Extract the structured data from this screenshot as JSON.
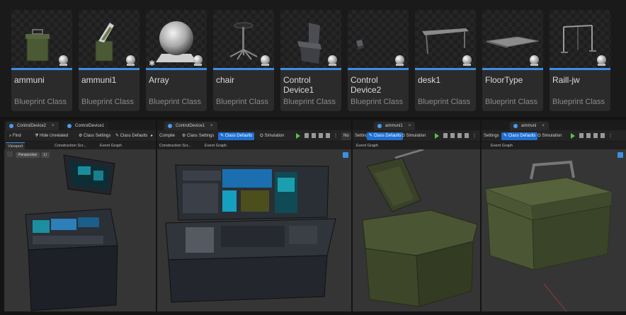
{
  "assets": [
    {
      "name": "ammuni",
      "type": "Blueprint Class",
      "icon": "ammo-box-icon"
    },
    {
      "name": "ammuni1",
      "type": "Blueprint Class",
      "icon": "ammo-box-open-icon"
    },
    {
      "name": "Array",
      "type": "Blueprint Class",
      "icon": "sphere-icon"
    },
    {
      "name": "chair",
      "type": "Blueprint Class",
      "icon": "office-chair-icon"
    },
    {
      "name": "Control Device1",
      "type": "Blueprint Class",
      "icon": "control-device-icon"
    },
    {
      "name": "Control Device2",
      "type": "Blueprint Class",
      "icon": "small-device-icon"
    },
    {
      "name": "desk1",
      "type": "Blueprint Class",
      "icon": "desk-icon"
    },
    {
      "name": "FloorType",
      "type": "Blueprint Class",
      "icon": "floor-tile-icon"
    },
    {
      "name": "Raill-jw",
      "type": "Blueprint Class",
      "icon": "rail-icon"
    }
  ],
  "editors": [
    {
      "tabs": [
        "ControlDevice2",
        "ControlDevice1"
      ],
      "toolbar": {
        "first": "Find",
        "second": "Hide Unrelated",
        "third": "Class Settings",
        "fourth": "Class Defaults"
      },
      "subtabs": [
        "Viewport",
        "Construction Scr...",
        "Event Graph"
      ],
      "viewport": {
        "mode": "Perspective",
        "lit": "Li"
      }
    },
    {
      "tabs": [
        "ControlDevice1"
      ],
      "toolbar": {
        "first": "Compile",
        "second": "Class Settings",
        "third": "Class Defaults",
        "fourth": "Simulation"
      },
      "subtabs": [
        "Construction Scr...",
        "Event Graph"
      ]
    },
    {
      "tabs": [
        "ammuni1"
      ],
      "toolbar": {
        "first": "Settings",
        "second": "Class Defaults",
        "third": "Simulation"
      },
      "subtabs": [
        "Event Graph"
      ]
    },
    {
      "tabs": [
        "ammuni"
      ],
      "toolbar": {
        "first": "Settings",
        "second": "Class Defaults",
        "third": "Simulation"
      },
      "subtabs": [
        "Event Graph"
      ]
    }
  ],
  "colors": {
    "accent": "#3b8fe6",
    "play": "#5cc04b",
    "active_tab": "#1f6fd1"
  }
}
